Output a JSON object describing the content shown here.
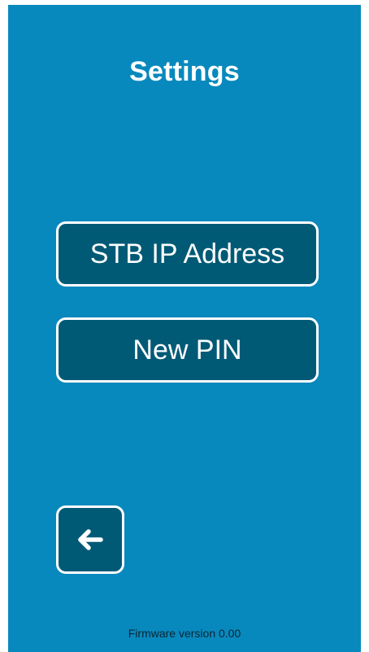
{
  "screen": {
    "title": "Settings",
    "background_color": "#0889bd"
  },
  "menu": {
    "items": [
      {
        "label": "STB IP Address"
      },
      {
        "label": "New PIN"
      }
    ],
    "button_color": "#005a76",
    "border_color": "#ffffff"
  },
  "back_button": {
    "icon": "arrow-left-icon"
  },
  "footer": {
    "firmware_text": "Firmware version 0.00"
  }
}
